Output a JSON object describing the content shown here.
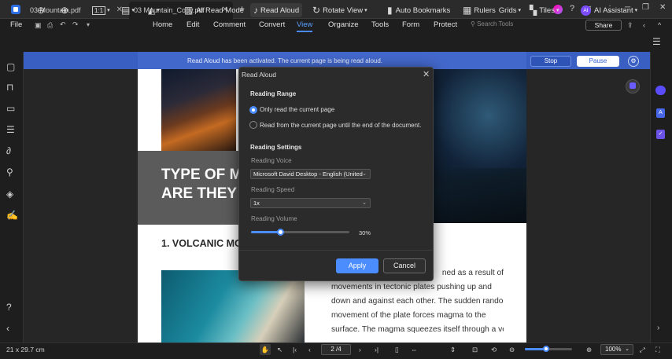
{
  "tabs": [
    {
      "label": "03 Mountain.pdf"
    },
    {
      "label": "03 Mountain_Copy.pdf"
    }
  ],
  "window_controls": {
    "minimize": "─",
    "maximize": "❐",
    "close": "✕",
    "new_tab": "+",
    "close_tab": "✕"
  },
  "menu": {
    "file": "File",
    "items": [
      "Home",
      "Edit",
      "Comment",
      "Convert",
      "View",
      "Organize",
      "Tools",
      "Form",
      "Protect"
    ],
    "search_placeholder": "Search Tools",
    "share": "Share"
  },
  "toolbar": {
    "fit_label": "1:1",
    "read_mode": "AI Read Mode",
    "read_aloud": "Read Aloud",
    "rotate_view": "Rotate View",
    "auto_bookmarks": "Auto Bookmarks",
    "rulers": "Rulers",
    "grids": "Grids",
    "tiles": "Tiles",
    "ai_assistant": "AI Assistant",
    "ai_badge": "AI"
  },
  "banner": {
    "text": "Read Aloud has been activated. The current page is being read aloud.",
    "stop": "Stop",
    "pause": "Pause"
  },
  "document": {
    "title_line1": "TYPE OF MO",
    "title_line2": "ARE THEY F",
    "heading": "1. VOLCANIC MO",
    "body_lines": [
      "ned as a result of",
      "movements in tectonic plates pushing up and",
      "down and against each other. The sudden random",
      "movement of the plate forces magma to the",
      "surface. The magma squeezes itself through a vent"
    ]
  },
  "dialog": {
    "title": "Read Aloud",
    "reading_range": "Reading Range",
    "option_current": "Only read the current page",
    "option_to_end": "Read from the current page until the end of the document.",
    "reading_settings": "Reading Settings",
    "voice_label": "Reading Voice",
    "voice_value": "Microsoft David Desktop - English (United",
    "speed_label": "Reading Speed",
    "speed_value": "1x",
    "volume_label": "Reading Volume",
    "volume_value": "30%",
    "volume_fraction": 0.3,
    "apply": "Apply",
    "cancel": "Cancel"
  },
  "status": {
    "page_size": "21 x 29.7 cm",
    "page_indicator": "2 /4",
    "zoom": "100%"
  },
  "colors": {
    "accent": "#4b8cff",
    "banner": "#3b62c9",
    "background": "#1e1e1e"
  }
}
